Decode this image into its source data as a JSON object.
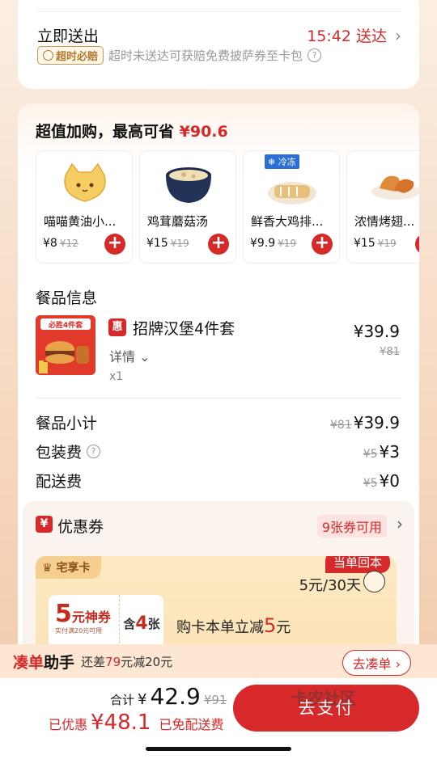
{
  "delivery": {
    "title": "立即送出",
    "time": "15:42 送达",
    "ontime_badge": "超时必赔",
    "ontime_text": "超时未送达可获赔免费披萨券至卡包"
  },
  "addon": {
    "title": "超值加购，最高可省",
    "save_amount": "¥90.6",
    "items": [
      {
        "name": "喵喵黄油小...",
        "price": "¥8",
        "orig": "¥12",
        "tag": ""
      },
      {
        "name": "鸡茸蘑菇汤",
        "price": "¥15",
        "orig": "¥19",
        "tag": ""
      },
      {
        "name": "鲜香大鸡排...",
        "price": "¥9.9",
        "orig": "¥19",
        "tag": "冷冻"
      },
      {
        "name": "浓情烤翅...",
        "price": "¥15",
        "orig": "¥19",
        "tag": ""
      }
    ]
  },
  "meal": {
    "section": "餐品信息",
    "badge": "惠",
    "name": "招牌汉堡4件套",
    "detail": "详情",
    "qty": "x1",
    "price": "¥39.9",
    "orig": "¥81",
    "img_text": "必胜4件套"
  },
  "fees": {
    "subtotal_label": "餐品小计",
    "subtotal_orig": "¥81",
    "subtotal_val": "¥39.9",
    "packing_label": "包装费",
    "packing_orig": "¥5",
    "packing_val": "¥3",
    "delivery_label": "配送费",
    "delivery_orig": "¥5",
    "delivery_val": "¥0"
  },
  "coupon": {
    "icon": "¥",
    "title": "优惠券",
    "available": "9张券可用",
    "vip_tag": "宅享卡",
    "vip_ribbon": "当单回本",
    "vip_price": "5元/30天",
    "vip_coupon_amt": "5",
    "vip_coupon_unit": "元神券",
    "vip_coupon_note": "实付满20元可用",
    "vip_coupon_count_pre": "含",
    "vip_coupon_count": "4",
    "vip_coupon_count_post": "张",
    "vip_desc_pre": "购卡本单立减",
    "vip_desc_amt": "5",
    "vip_desc_post": "元"
  },
  "helper": {
    "brand_red": "凑单",
    "brand_black": "助手",
    "text_pre": "还差",
    "text_amt": "79",
    "text_post": "元减20元",
    "button": "去凑单"
  },
  "bottom": {
    "total_label": "合计",
    "total_yen": "¥",
    "total_amt": "42.9",
    "total_orig": "¥91",
    "saved_label": "已优惠",
    "saved_amt": "¥48.1",
    "free_delivery": "已免配送费",
    "pay_button": "去支付",
    "watermark": "卡农社区"
  },
  "colors": {
    "accent": "#d7282a",
    "vip": "#fbe1b2"
  }
}
